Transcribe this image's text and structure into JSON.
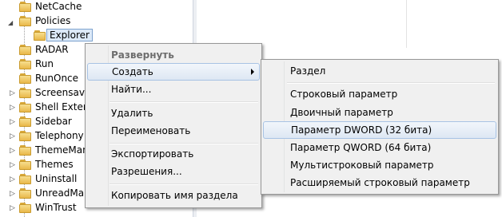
{
  "tree": {
    "items": [
      {
        "label": "NetCache",
        "expander": ""
      },
      {
        "label": "Policies",
        "expander": "◢"
      },
      {
        "label": "Explorer",
        "expander": "",
        "selected": true
      },
      {
        "label": "RADAR",
        "expander": ""
      },
      {
        "label": "Run",
        "expander": ""
      },
      {
        "label": "RunOnce",
        "expander": ""
      },
      {
        "label": "Screensaver",
        "expander": "▷"
      },
      {
        "label": "Shell Extens",
        "expander": "▷"
      },
      {
        "label": "Sidebar",
        "expander": "▷"
      },
      {
        "label": "Telephony",
        "expander": "▷"
      },
      {
        "label": "ThemeMan",
        "expander": "▷"
      },
      {
        "label": "Themes",
        "expander": "▷"
      },
      {
        "label": "Uninstall",
        "expander": "▷"
      },
      {
        "label": "UnreadMail",
        "expander": "▷"
      },
      {
        "label": "WinTrust",
        "expander": "▷"
      }
    ]
  },
  "context_menu": {
    "items": [
      {
        "label": "Развернуть"
      },
      {
        "label": "Создать"
      },
      {
        "label": "Найти..."
      },
      {
        "label": "Удалить"
      },
      {
        "label": "Переименовать"
      },
      {
        "label": "Экспортировать"
      },
      {
        "label": "Разрешения..."
      },
      {
        "label": "Копировать имя раздела"
      }
    ]
  },
  "submenu": {
    "items": [
      {
        "label": "Раздел"
      },
      {
        "label": "Строковый параметр"
      },
      {
        "label": "Двоичный параметр"
      },
      {
        "label": "Параметр DWORD (32 бита)"
      },
      {
        "label": "Параметр QWORD (64 бита)"
      },
      {
        "label": "Мультистроковый параметр"
      },
      {
        "label": "Расширяемый строковый параметр"
      }
    ]
  }
}
